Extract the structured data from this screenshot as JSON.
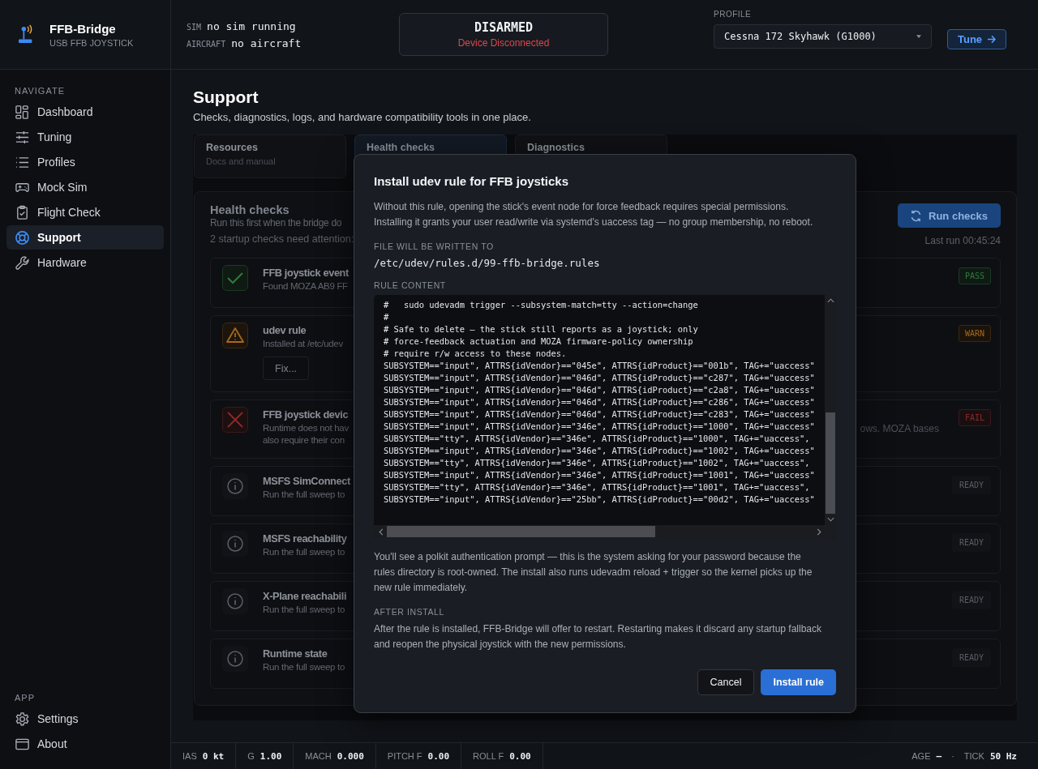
{
  "brand": {
    "name": "FFB-Bridge",
    "subtitle": "USB FFB JOYSTICK"
  },
  "sim_status": [
    {
      "label": "SIM",
      "value": "no sim running"
    },
    {
      "label": "AIRCRAFT",
      "value": "no aircraft"
    }
  ],
  "arm_state": {
    "title": "DISARMED",
    "status": "Device Disconnected",
    "armed": false
  },
  "profile": {
    "label": "PROFILE",
    "value": "Cessna 172 Skyhawk (G1000)"
  },
  "tune_button": "Tune",
  "sidebar": {
    "sections": [
      {
        "heading": "NAVIGATE",
        "items": [
          {
            "label": "Dashboard",
            "selected": false
          },
          {
            "label": "Tuning",
            "selected": false
          },
          {
            "label": "Profiles",
            "selected": false
          },
          {
            "label": "Mock Sim",
            "selected": false
          },
          {
            "label": "Flight Check",
            "selected": false
          },
          {
            "label": "Support",
            "selected": true
          },
          {
            "label": "Hardware",
            "selected": false
          }
        ]
      },
      {
        "heading": "APP",
        "items": [
          {
            "label": "Settings",
            "selected": false
          },
          {
            "label": "About",
            "selected": false
          }
        ]
      }
    ]
  },
  "page": {
    "title": "Support",
    "subtitle": "Checks, diagnostics, logs, and hardware compatibility tools in one place."
  },
  "tabs": [
    {
      "title": "Resources",
      "subtitle": "Docs and manual",
      "selected": false
    },
    {
      "title": "Health checks",
      "selected": true
    },
    {
      "title": "Diagnostics",
      "selected": false
    }
  ],
  "health": {
    "title": "Health checks",
    "description": "Run this first when the bridge do",
    "summary": "2 startup checks need attention:",
    "run_button": "Run checks",
    "last_run": "Last run 00:45:24",
    "checks": [
      {
        "kind": "pass",
        "title": "FFB joystick event",
        "lines": [
          "Found MOZA AB9 FF"
        ],
        "badge": "PASS"
      },
      {
        "kind": "warn",
        "title": "udev rule",
        "lines": [
          "Installed at /etc/udev"
        ],
        "action": "Fix...",
        "badge": "WARN"
      },
      {
        "kind": "fail",
        "title": "FFB joystick devic",
        "lines": [
          "Runtime does not hav",
          "also require their con"
        ],
        "tail": "ows. MOZA bases",
        "badge": "FAIL"
      },
      {
        "kind": "ready",
        "title": "MSFS SimConnect",
        "lines": [
          "Run the full sweep to"
        ],
        "badge": "READY"
      },
      {
        "kind": "ready",
        "title": "MSFS reachability",
        "lines": [
          "Run the full sweep to"
        ],
        "badge": "READY"
      },
      {
        "kind": "ready",
        "title": "X-Plane reachabili",
        "lines": [
          "Run the full sweep to"
        ],
        "badge": "READY"
      },
      {
        "kind": "ready",
        "title": "Runtime state",
        "lines": [
          "Run the full sweep to"
        ],
        "badge": "READY"
      }
    ]
  },
  "dialog": {
    "title": "Install udev rule for FFB joysticks",
    "intro": "Without this rule, opening the stick's event node for force feedback requires special permissions. Installing it grants your user read/write via systemd's uaccess tag — no group membership, no reboot.",
    "file_label": "FILE WILL BE WRITTEN TO",
    "file_path": "/etc/udev/rules.d/99-ffb-bridge.rules",
    "content_label": "RULE CONTENT",
    "code_lines": [
      "#   sudo udevadm trigger --subsystem-match=tty --action=change",
      "#",
      "# Safe to delete — the stick still reports as a joystick; only",
      "# force-feedback actuation and MOZA firmware-policy ownership",
      "# require r/w access to these nodes.",
      "SUBSYSTEM==\"input\", ATTRS{idVendor}==\"045e\", ATTRS{idProduct}==\"001b\", TAG+=\"uaccess\"",
      "SUBSYSTEM==\"input\", ATTRS{idVendor}==\"046d\", ATTRS{idProduct}==\"c287\", TAG+=\"uaccess\"",
      "SUBSYSTEM==\"input\", ATTRS{idVendor}==\"046d\", ATTRS{idProduct}==\"c2a8\", TAG+=\"uaccess\"",
      "SUBSYSTEM==\"input\", ATTRS{idVendor}==\"046d\", ATTRS{idProduct}==\"c286\", TAG+=\"uaccess\"",
      "SUBSYSTEM==\"input\", ATTRS{idVendor}==\"046d\", ATTRS{idProduct}==\"c283\", TAG+=\"uaccess\"",
      "SUBSYSTEM==\"input\", ATTRS{idVendor}==\"346e\", ATTRS{idProduct}==\"1000\", TAG+=\"uaccess\"",
      "SUBSYSTEM==\"tty\", ATTRS{idVendor}==\"346e\", ATTRS{idProduct}==\"1000\", TAG+=\"uaccess\",",
      "SUBSYSTEM==\"input\", ATTRS{idVendor}==\"346e\", ATTRS{idProduct}==\"1002\", TAG+=\"uaccess\"",
      "SUBSYSTEM==\"tty\", ATTRS{idVendor}==\"346e\", ATTRS{idProduct}==\"1002\", TAG+=\"uaccess\",",
      "SUBSYSTEM==\"input\", ATTRS{idVendor}==\"346e\", ATTRS{idProduct}==\"1001\", TAG+=\"uaccess\"",
      "SUBSYSTEM==\"tty\", ATTRS{idVendor}==\"346e\", ATTRS{idProduct}==\"1001\", TAG+=\"uaccess\",",
      "SUBSYSTEM==\"input\", ATTRS{idVendor}==\"25bb\", ATTRS{idProduct}==\"00d2\", TAG+=\"uaccess\""
    ],
    "note": "You'll see a polkit authentication prompt — this is the system asking for your password because the rules directory is root-owned. The install also runs udevadm reload + trigger so the kernel picks up the new rule immediately.",
    "after_label": "AFTER INSTALL",
    "after_text": "After the rule is installed, FFB-Bridge will offer to restart. Restarting makes it discard any startup fallback and reopen the physical joystick with the new permissions.",
    "cancel_button": "Cancel",
    "confirm_button": "Install rule"
  },
  "status_bar": {
    "readings": [
      {
        "label": "IAS",
        "value": "0 kt"
      },
      {
        "label": "G",
        "value": "1.00"
      },
      {
        "label": "MACH",
        "value": "0.000"
      },
      {
        "label": "PITCH F",
        "value": "0.00"
      },
      {
        "label": "ROLL F",
        "value": "0.00"
      }
    ],
    "age_label": "AGE",
    "age_value": "—",
    "separator": "·",
    "tick_label": "TICK",
    "tick_value": "50 Hz"
  }
}
